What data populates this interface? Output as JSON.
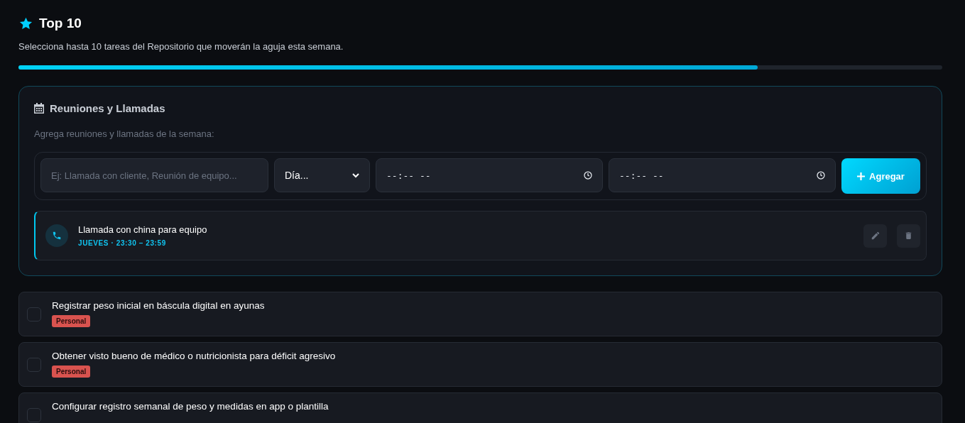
{
  "header": {
    "title": "Top 10",
    "subtitle": "Selecciona hasta 10 tareas del Repositorio que moverán la aguja esta semana.",
    "progress": {
      "level": 0.8
    }
  },
  "meetings": {
    "title": "Reuniones y Llamadas",
    "hint": "Agrega reuniones y llamadas de la semana:",
    "form": {
      "name": {
        "placeholder": "Ej: Llamada con cliente, Reunión de equipo..."
      },
      "day": {
        "value": "Día..."
      },
      "start": {
        "value": "--:-- --"
      },
      "end": {
        "value": "--:-- --"
      },
      "submit": "Agregar"
    },
    "items": [
      {
        "kind": "call",
        "title": "Llamada con china para equipo",
        "when": "JUEVES · 23:30 – 23:59"
      }
    ]
  },
  "tasks": [
    {
      "title": "Registrar peso inicial en báscula digital en ayunas",
      "checked": false,
      "tag": "Personal",
      "color": "#d9534f"
    },
    {
      "title": "Obtener visto bueno de médico o nutricionista para déficit agresivo",
      "checked": false,
      "tag": "Personal",
      "color": "#d9534f"
    },
    {
      "title": "Configurar registro semanal de peso y medidas en app o plantilla",
      "checked": false
    }
  ]
}
